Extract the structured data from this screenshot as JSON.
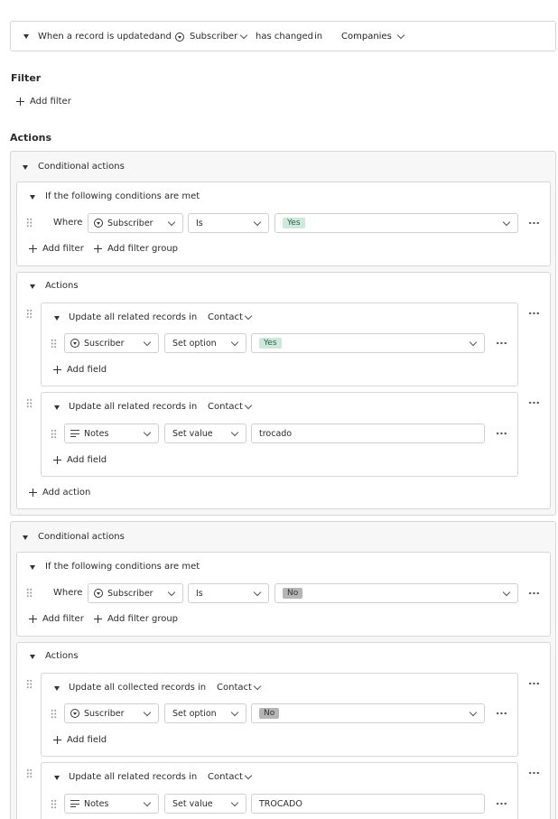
{
  "trigger": {
    "text1": "When a record is updated",
    "and": "and",
    "field": "Subscriber",
    "changed": "has changed",
    "in": "in",
    "object": "Companies"
  },
  "filter": {
    "heading": "Filter",
    "add": "Add filter"
  },
  "actions_heading": "Actions",
  "blocks": [
    {
      "title": "Conditional actions",
      "condition_title": "If the following conditions are met",
      "where": "Where",
      "field": "Subscriber",
      "operator": "Is",
      "value": "Yes",
      "add_filter": "Add filter",
      "add_filter_group": "Add filter group",
      "actions_title": "Actions",
      "items": [
        {
          "title": "Update all related records in",
          "object": "Contact",
          "field": "Suscriber",
          "op": "Set option",
          "value": "Yes",
          "add_field": "Add field"
        },
        {
          "title": "Update all related records in",
          "object": "Contact",
          "field": "Notes",
          "op": "Set value",
          "value": "trocado",
          "add_field": "Add field"
        }
      ],
      "add_action": "Add action"
    },
    {
      "title": "Conditional actions",
      "condition_title": "If the following conditions are met",
      "where": "Where",
      "field": "Subscriber",
      "operator": "Is",
      "value": "No",
      "add_filter": "Add filter",
      "add_filter_group": "Add filter group",
      "actions_title": "Actions",
      "items": [
        {
          "title": "Update all collected records in",
          "object": "Contact",
          "field": "Suscriber",
          "op": "Set option",
          "value": "No",
          "add_field": "Add field"
        },
        {
          "title": "Update all related records in",
          "object": "Contact",
          "field": "Notes",
          "op": "Set value",
          "value": "TROCADO"
        }
      ]
    }
  ]
}
